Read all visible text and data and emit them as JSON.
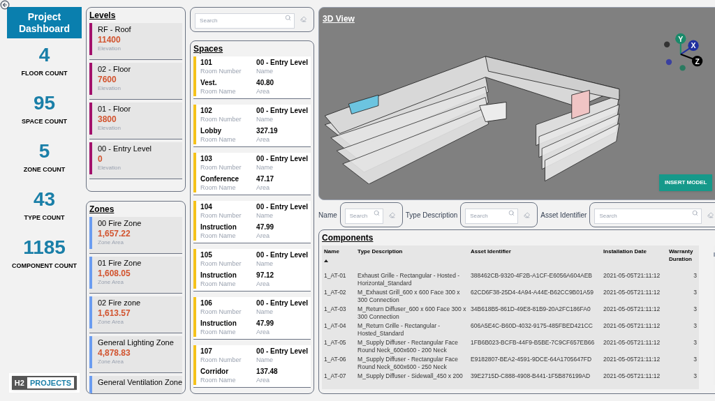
{
  "title_button": {
    "label": "Project Dashboard"
  },
  "stats": [
    {
      "value": "4",
      "label": "FLOOR COUNT"
    },
    {
      "value": "95",
      "label": "SPACE COUNT"
    },
    {
      "value": "5",
      "label": "ZONE COUNT"
    },
    {
      "value": "43",
      "label": "TYPE COUNT"
    },
    {
      "value": "1185",
      "label": "COMPONENT COUNT"
    }
  ],
  "logo": {
    "left": "H2",
    "right": "PROJECTS"
  },
  "levels": {
    "title": "Levels",
    "items": [
      {
        "name": "RF - Roof",
        "value": "11400",
        "caption": "Elevation"
      },
      {
        "name": "02 - Floor",
        "value": "7600",
        "caption": "Elevation"
      },
      {
        "name": "01 - Floor",
        "value": "3800",
        "caption": "Elevation"
      },
      {
        "name": "00 - Entry Level",
        "value": "0",
        "caption": "Elevation"
      }
    ]
  },
  "zones": {
    "title": "Zones",
    "items": [
      {
        "name": "00 Fire Zone",
        "value": "1,657.22",
        "caption": "Zone Area"
      },
      {
        "name": "01 Fire Zone",
        "value": "1,608.05",
        "caption": "Zone Area"
      },
      {
        "name": "02 Fire zone",
        "value": "1,613.57",
        "caption": "Zone Area"
      },
      {
        "name": "General Lighting Zone",
        "value": "4,878.83",
        "caption": "Zone Area"
      },
      {
        "name": "General Ventilation Zone"
      }
    ]
  },
  "space_search": {
    "placeholder": "Search"
  },
  "spaces": {
    "title": "Spaces",
    "items": [
      {
        "number": "101",
        "number_caption": "Room Number",
        "level": "00 - Entry Level",
        "level_caption": "Name",
        "room": "Vest.",
        "room_caption": "Room Name",
        "area": "40.80",
        "area_caption": "Area"
      },
      {
        "number": "102",
        "number_caption": "Room Number",
        "level": "00 - Entry Level",
        "level_caption": "Name",
        "room": "Lobby",
        "room_caption": "Room Name",
        "area": "327.19",
        "area_caption": "Area"
      },
      {
        "number": "103",
        "number_caption": "Room Number",
        "level": "00 - Entry Level",
        "level_caption": "Name",
        "room": "Conference",
        "room_caption": "Room Name",
        "area": "47.17",
        "area_caption": "Area"
      },
      {
        "number": "104",
        "number_caption": "Room Number",
        "level": "00 - Entry Level",
        "level_caption": "Name",
        "room": "Instruction",
        "room_caption": "Room Name",
        "area": "47.99",
        "area_caption": "Area"
      },
      {
        "number": "105",
        "number_caption": "Room Number",
        "level": "00 - Entry Level",
        "level_caption": "Name",
        "room": "Instruction",
        "room_caption": "Room Name",
        "area": "97.12",
        "area_caption": "Area"
      },
      {
        "number": "106",
        "number_caption": "Room Number",
        "level": "00 - Entry Level",
        "level_caption": "Name",
        "room": "Instruction",
        "room_caption": "Room Name",
        "area": "47.99",
        "area_caption": "Area"
      },
      {
        "number": "107",
        "number_caption": "Room Number",
        "level": "00 - Entry Level",
        "level_caption": "Name",
        "room": "Corridor",
        "room_caption": "Room Name",
        "area": "137.48",
        "area_caption": "Area"
      }
    ]
  },
  "view3d": {
    "title": "3D View",
    "axes": [
      "Y",
      "X",
      "Z"
    ],
    "button": "INSERT MODEL"
  },
  "filters": [
    {
      "label": "Name",
      "placeholder": "Search"
    },
    {
      "label": "Type Description",
      "placeholder": "Search"
    },
    {
      "label": "Asset Identifier",
      "placeholder": "Search"
    }
  ],
  "components": {
    "title": "Components",
    "columns": [
      "Name",
      "Type Description",
      "Asset Identifier",
      "Installation Date",
      "Warranty Duration"
    ],
    "rows": [
      [
        "1_AT-01",
        "Exhaust Grille - Rectangular - Hosted - Horizontal_Standard",
        "388462CB-9320-4F2B-A1CF-E6056A604AEB",
        "2021-05-05T21:11:12",
        "3"
      ],
      [
        "1_AT-02",
        "M_Exhaust Grill_600 x 600 Face 300 x 300 Connection",
        "62CD6F38-25D4-4A94-A44E-B62CC9B01A59",
        "2021-05-05T21:11:12",
        "3"
      ],
      [
        "1_AT-03",
        "M_Return Diffuser_600 x 600 Face 300 x 300 Connection",
        "34B618B5-861D-49E8-81B9-20A2FC186FA0",
        "2021-05-05T21:11:12",
        "3"
      ],
      [
        "1_AT-04",
        "M_Return Grille - Rectangular - Hosted_Standard",
        "606A5E4C-B60D-4032-9175-485FBED421CC",
        "2021-05-05T21:11:12",
        "3"
      ],
      [
        "1_AT-05",
        "M_Supply Diffuser - Rectangular Face Round Neck_600x600 - 200 Neck",
        "1FB6B023-BCFB-44F9-B5BE-7C9CF657EB66",
        "2021-05-05T21:11:12",
        "3"
      ],
      [
        "1_AT-06",
        "M_Supply Diffuser - Rectangular Face Round Neck_600x600 - 250 Neck",
        "E9182807-BEA2-4591-9DCE-64A1705647FD",
        "2021-05-05T21:11:12",
        "3"
      ],
      [
        "1_AT-07",
        "M_Supply Diffuser - Sidewall_450 x 200",
        "39E2715D-C888-4908-B441-1F5B876199AD",
        "2021-05-05T21:11:12",
        "3"
      ]
    ]
  }
}
